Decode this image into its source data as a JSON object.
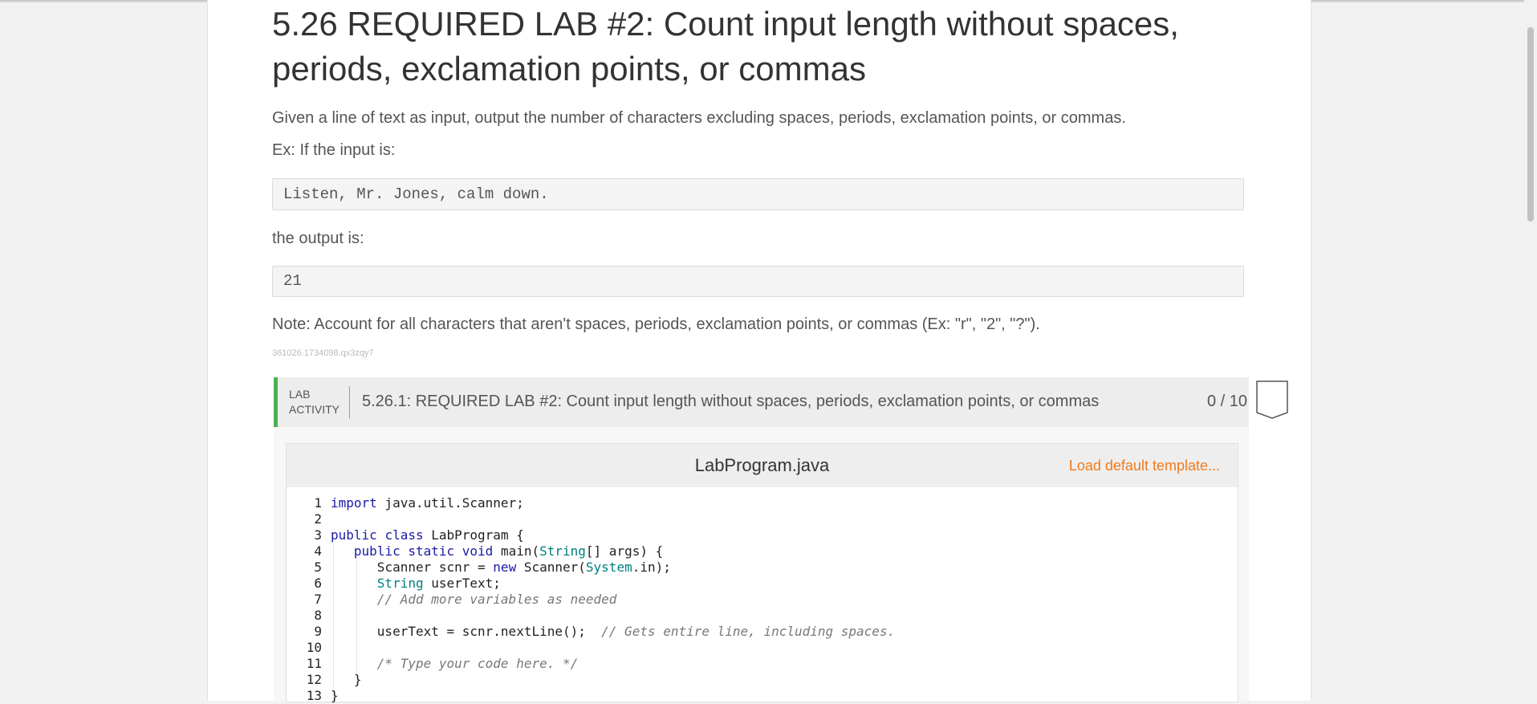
{
  "heading": "5.26 REQUIRED LAB #2: Count input length without spaces, periods, exclamation points, or commas",
  "intro": "Given a line of text as input, output the number of characters excluding spaces, periods, exclamation points, or commas.",
  "example_label": "Ex: If the input is:",
  "example_input": "Listen, Mr. Jones, calm down.",
  "output_label": "the output is:",
  "example_output": "21",
  "note": "Note: Account for all characters that aren't spaces, periods, exclamation points, or commas (Ex: \"r\", \"2\", \"?\").",
  "content_id": "361026.1734098.qx3zqy7",
  "lab": {
    "tag_line1": "LAB",
    "tag_line2": "ACTIVITY",
    "title": "5.26.1: REQUIRED LAB #2: Count input length without spaces, periods, exclamation points, or commas",
    "score": "0 / 10",
    "accent_color": "#4caf50"
  },
  "editor": {
    "file_name": "LabProgram.java",
    "load_template": "Load default template...",
    "line_numbers": [
      "1",
      "2",
      "3",
      "4",
      "5",
      "6",
      "7",
      "8",
      "9",
      "10",
      "11",
      "12",
      "13"
    ]
  },
  "colors": {
    "link": "#f07b1c",
    "keyword": "#1a1aa6",
    "type": "#008080"
  }
}
